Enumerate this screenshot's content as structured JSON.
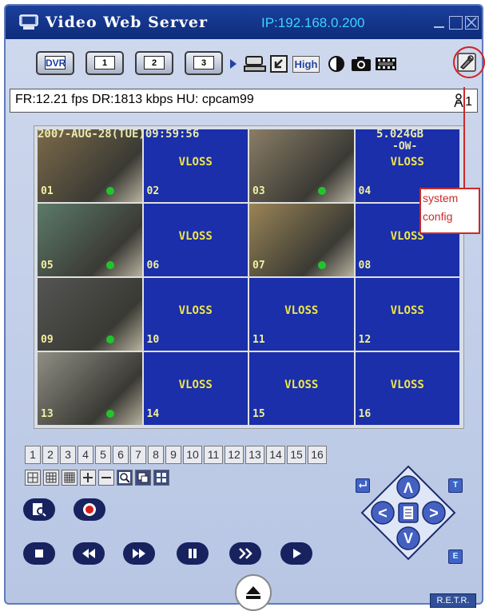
{
  "window": {
    "title": "Video Web Server",
    "ip_label": "IP:192.168.0.200"
  },
  "toolbar": {
    "dvr_label": "DVR",
    "channel_buttons": [
      "1",
      "2",
      "3"
    ],
    "quality_label": "High",
    "icons": [
      "network-icon",
      "resize-icon",
      "quality-icon",
      "contrast-icon",
      "snapshot-icon",
      "film-icon",
      "system-config-icon"
    ]
  },
  "status": {
    "text": "FR:12.21 fps DR:1813 kbps HU: cpcam99",
    "user_count": "1"
  },
  "osd": {
    "datetime": "2007-AUG-28(TUE)09:59:56",
    "disk": "5.024GB",
    "mode": "-OW-"
  },
  "channels": [
    {
      "num": "01",
      "status": "video",
      "recording": true
    },
    {
      "num": "02",
      "status": "VLOSS",
      "recording": false
    },
    {
      "num": "03",
      "status": "video",
      "recording": true
    },
    {
      "num": "04",
      "status": "VLOSS",
      "recording": false
    },
    {
      "num": "05",
      "status": "video",
      "recording": true
    },
    {
      "num": "06",
      "status": "VLOSS",
      "recording": false
    },
    {
      "num": "07",
      "status": "video",
      "recording": true
    },
    {
      "num": "08",
      "status": "VLOSS",
      "recording": false
    },
    {
      "num": "09",
      "status": "video",
      "recording": true
    },
    {
      "num": "10",
      "status": "VLOSS",
      "recording": false
    },
    {
      "num": "11",
      "status": "VLOSS",
      "recording": false
    },
    {
      "num": "12",
      "status": "VLOSS",
      "recording": false
    },
    {
      "num": "13",
      "status": "video",
      "recording": true
    },
    {
      "num": "14",
      "status": "VLOSS",
      "recording": false
    },
    {
      "num": "15",
      "status": "VLOSS",
      "recording": false
    },
    {
      "num": "16",
      "status": "VLOSS",
      "recording": false
    }
  ],
  "callout": {
    "line1": "system",
    "line2": "config"
  },
  "channel_select": [
    "1",
    "2",
    "3",
    "4",
    "5",
    "6",
    "7",
    "8",
    "9",
    "10",
    "11",
    "12",
    "13",
    "14",
    "15",
    "16"
  ],
  "layout_buttons": [
    "quad-view-icon",
    "nine-view-icon",
    "sixteen-view-icon",
    "zoom-in-icon",
    "zoom-out-icon",
    "magnify-icon",
    "pip-icon",
    "split-icon"
  ],
  "ptz": {
    "top_left": "",
    "top_right": "T",
    "bottom_right": "E"
  },
  "playback_icons": [
    "stop-icon",
    "rewind-icon",
    "fast-forward-icon",
    "pause-icon",
    "step-forward-icon",
    "play-icon"
  ],
  "footer": {
    "retr_label": "R.E.T.R."
  },
  "colors": {
    "titlebar": "#1b3f9c",
    "ip_text": "#3cd3ff",
    "vloss_bg": "#1a2fa9",
    "vloss_text": "#f0e44a",
    "rec_dot": "#22c42e",
    "callout": "#c92a2a"
  }
}
